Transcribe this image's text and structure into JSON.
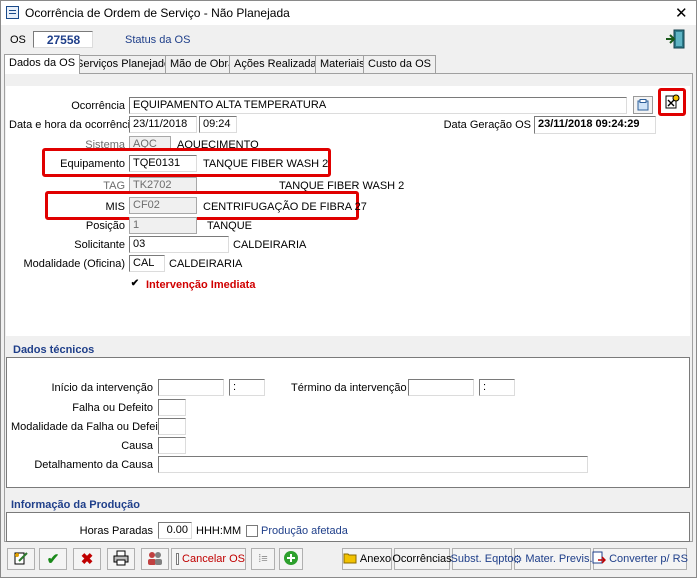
{
  "window": {
    "title": "Ocorrência de Ordem de Serviço - Não Planejada",
    "close_glyph": "✕"
  },
  "header": {
    "os_label": "OS",
    "os_number": "27558",
    "status_label": "Status da OS",
    "exit_icon": "exit-door-icon"
  },
  "tabs": [
    {
      "label": "Dados da OS",
      "active": true
    },
    {
      "label": "Serviços Planejados"
    },
    {
      "label": "Mão de Obra"
    },
    {
      "label": "Ações Realizadas"
    },
    {
      "label": "Materiais"
    },
    {
      "label": "Custo da OS"
    }
  ],
  "form": {
    "ocorrencia_label": "Ocorrência",
    "ocorrencia_value": "EQUIPAMENTO ALTA TEMPERATURA",
    "data_hora_label": "Data e hora da ocorrência",
    "data_value": "23/11/2018",
    "hora_value": "09:24",
    "data_geracao_label": "Data Geração OS",
    "data_geracao_value": "23/11/2018 09:24:29",
    "sistema_label": "Sistema",
    "sistema_code": "AQC",
    "sistema_desc": "AQUECIMENTO",
    "equipamento_label": "Equipamento",
    "equipamento_code": "TQE0131",
    "equipamento_desc": "TANQUE FIBER WASH 2",
    "tag_label": "TAG",
    "tag_code": "TK2702",
    "tag_desc": "TANQUE FIBER WASH 2",
    "mis_label": "MIS",
    "mis_code": "CF02",
    "mis_desc": "CENTRIFUGAÇÃO DE FIBRA 27",
    "posicao_label": "Posição",
    "posicao_code": "1",
    "posicao_desc": "TANQUE",
    "solicitante_label": "Solicitante",
    "solicitante_code": "03",
    "solicitante_desc": "CALDEIRARIA",
    "modalidade_label": "Modalidade (Oficina)",
    "modalidade_code": "CAL",
    "modalidade_desc": "CALDEIRARIA",
    "intervencao_label": "Intervenção Imediata",
    "intervencao_checked": true
  },
  "dados_tecnicos": {
    "title": "Dados técnicos",
    "inicio_label": "Início da intervenção",
    "inicio_time_sep": ":",
    "termino_label": "Término da intervenção",
    "termino_time_sep": ":",
    "falha_label": "Falha ou Defeito",
    "modalidade_falha_label": "Modalidade da Falha ou Defeito",
    "causa_label": "Causa",
    "detalhamento_label": "Detalhamento da Causa"
  },
  "producao": {
    "title": "Informação da Produção",
    "horas_label": "Horas Paradas",
    "horas_value": "0.00",
    "horas_unit": "HHH:MM",
    "producao_afetada_label": "Produção afetada",
    "producao_afetada_checked": false
  },
  "toolbar": {
    "cancelar_label": "Cancelar OS",
    "anexo_label": "Anexo",
    "ocorrencias_label": "Ocorrências",
    "subst_label": "Subst. Eqpto",
    "mater_label": "Mater. Previs.",
    "converter_label": "Converter p/ RS"
  },
  "colors": {
    "highlight_red": "#e00000",
    "section_blue": "#1f3f8a",
    "intervencao_red": "#d00000",
    "cancel_red": "#c00000",
    "link_blue": "#1f3f8a"
  }
}
